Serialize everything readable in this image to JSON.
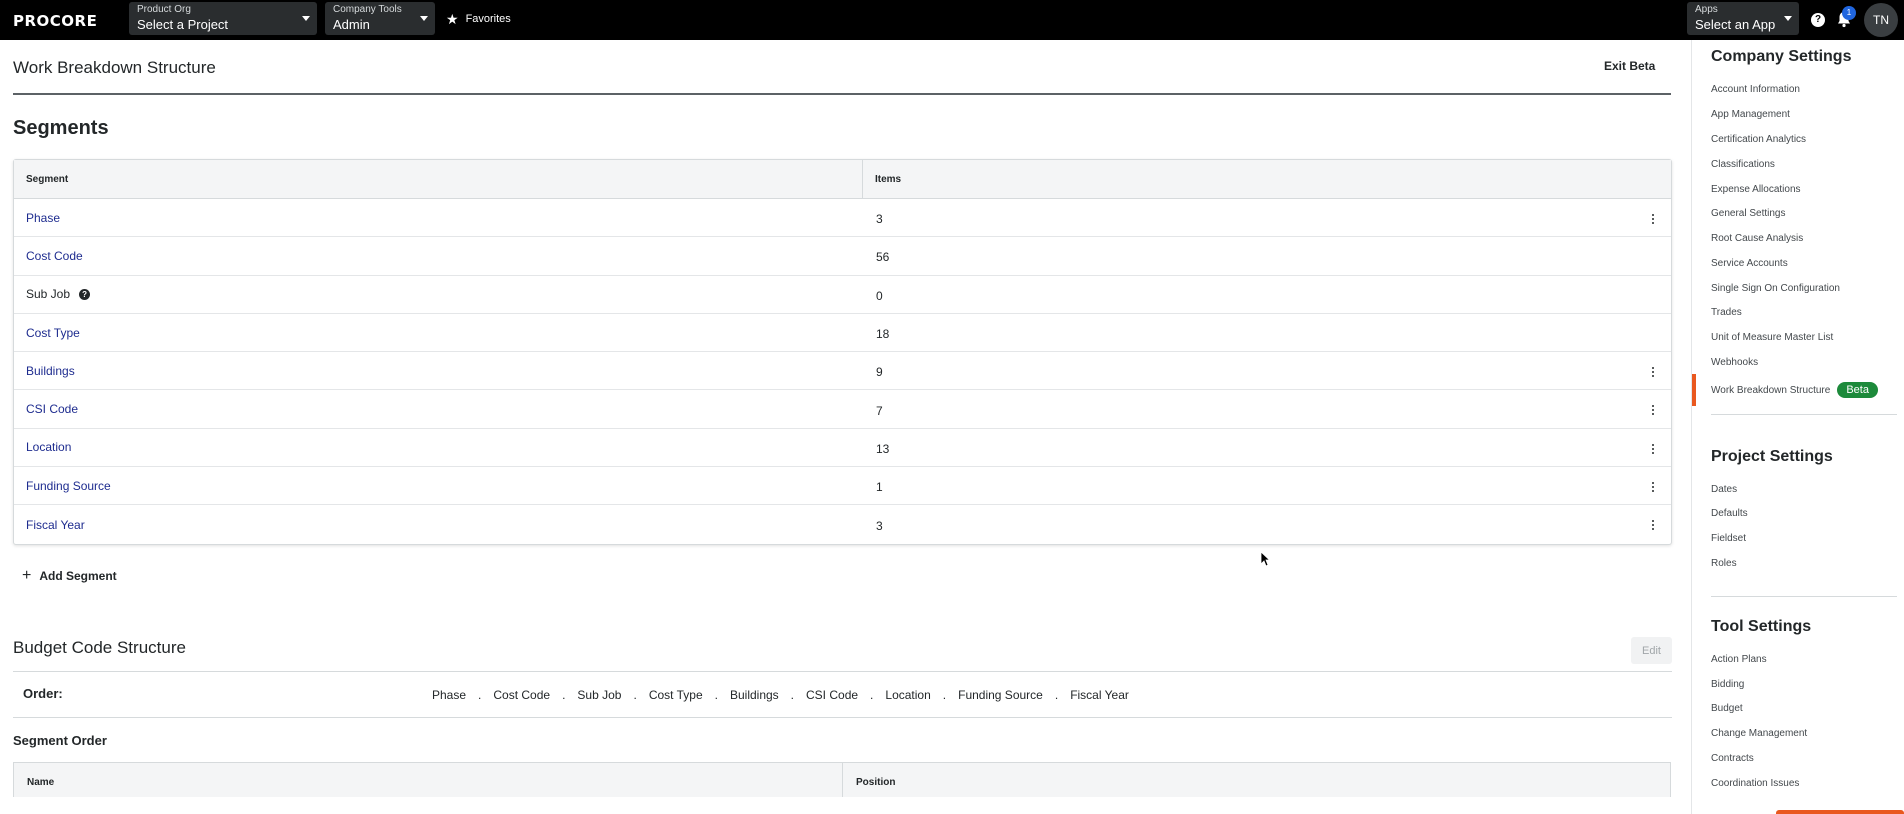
{
  "topnav": {
    "logo": "PROCORE",
    "product_org": {
      "caption": "Product Org",
      "value": "Select a Project"
    },
    "company_tools": {
      "caption": "Company Tools",
      "value": "Admin"
    },
    "favorites": "Favorites",
    "apps": {
      "caption": "Apps",
      "value": "Select an App"
    },
    "help_icon": "?",
    "notification_count": "1",
    "avatar_initials": "TN"
  },
  "page": {
    "title": "Work Breakdown Structure",
    "exit_beta": "Exit Beta"
  },
  "segments": {
    "heading": "Segments",
    "columns": [
      "Segment",
      "Items"
    ],
    "rows": [
      {
        "name": "Phase",
        "items": "3"
      },
      {
        "name": "Cost Code",
        "items": "56"
      },
      {
        "name": "Sub Job",
        "items": "0"
      },
      {
        "name": "Cost Type",
        "items": "18"
      },
      {
        "name": "Buildings",
        "items": "9"
      },
      {
        "name": "CSI Code",
        "items": "7"
      },
      {
        "name": "Location",
        "items": "13"
      },
      {
        "name": "Funding Source",
        "items": "1"
      },
      {
        "name": "Fiscal Year",
        "items": "3"
      }
    ],
    "add_label": "Add Segment"
  },
  "budget_code_structure": {
    "heading": "Budget Code Structure",
    "edit_label": "Edit",
    "order_label": "Order:",
    "order": [
      "Phase",
      "Cost Code",
      "Sub Job",
      "Cost Type",
      "Buildings",
      "CSI Code",
      "Location",
      "Funding Source",
      "Fiscal Year"
    ],
    "separator": ".",
    "segment_order_heading": "Segment Order",
    "segment_order_columns": [
      "Name",
      "Position"
    ]
  },
  "sidebar": {
    "company_settings": {
      "heading": "Company Settings",
      "items": [
        "Account Information",
        "App Management",
        "Certification Analytics",
        "Classifications",
        "Expense Allocations",
        "General Settings",
        "Root Cause Analysis",
        "Service Accounts",
        "Single Sign On Configuration",
        "Trades",
        "Unit of Measure Master List",
        "Webhooks",
        "Work Breakdown Structure"
      ],
      "active_badge": "Beta"
    },
    "project_settings": {
      "heading": "Project Settings",
      "items": [
        "Dates",
        "Defaults",
        "Fieldset",
        "Roles"
      ]
    },
    "tool_settings": {
      "heading": "Tool Settings",
      "items": [
        "Action Plans",
        "Bidding",
        "Budget",
        "Change Management",
        "Contracts",
        "Coordination Issues"
      ]
    }
  },
  "colors": {
    "nav_bg": "#000000",
    "link": "#1e2c8f",
    "accent": "#e9581f",
    "beta_badge": "#1d8a3b"
  }
}
